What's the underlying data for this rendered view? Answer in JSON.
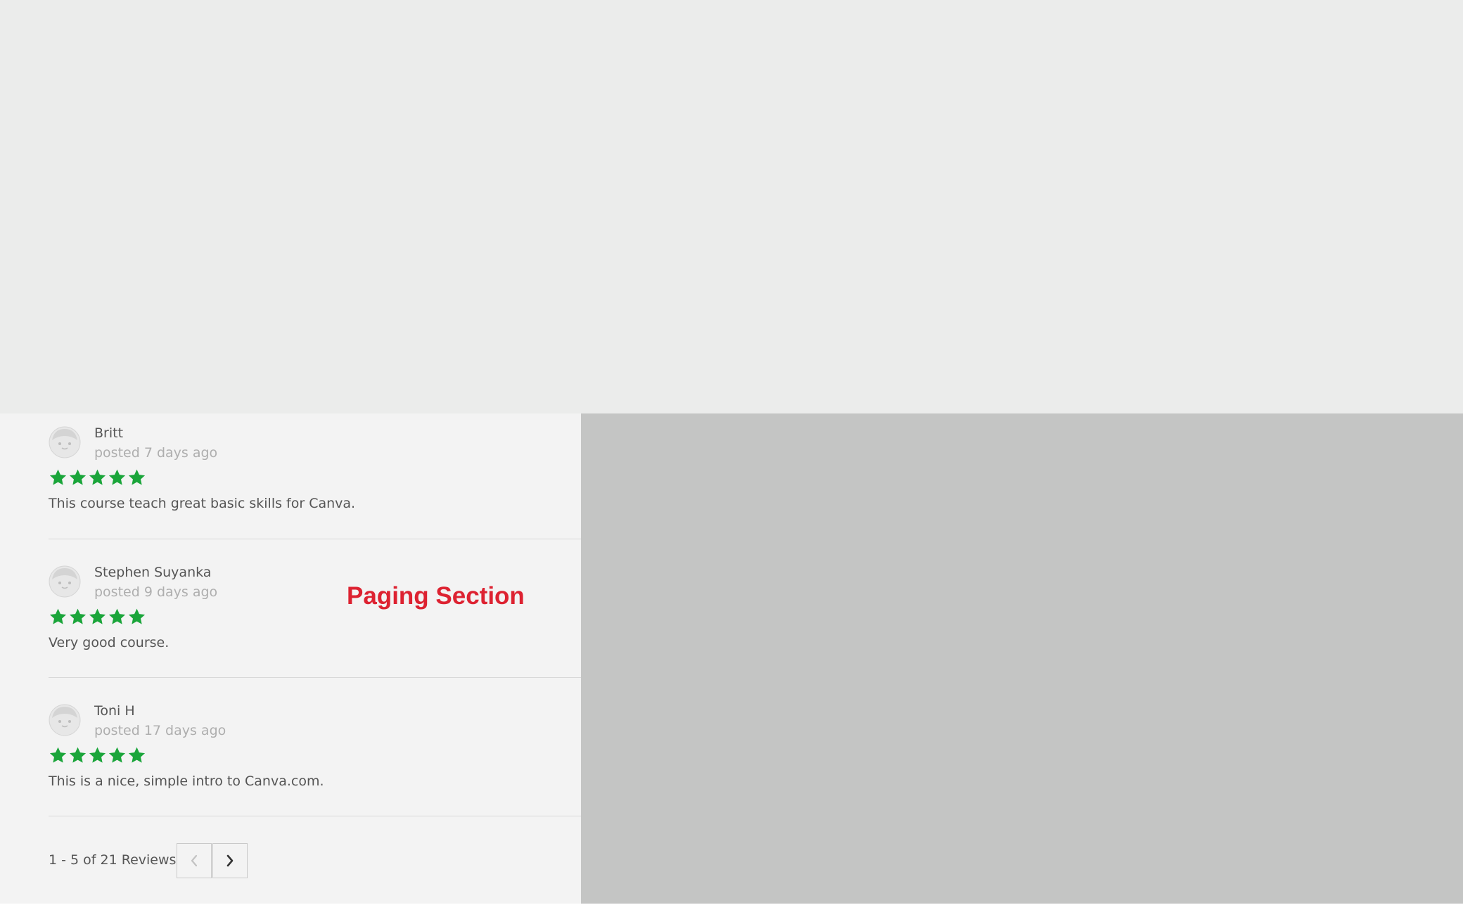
{
  "annotation": {
    "text": "Paging Section",
    "color": "#dd2231"
  },
  "reviews": [
    {
      "name": "Britt",
      "posted": "posted 7 days ago",
      "rating": 5,
      "text": "This course teach great basic skills for Canva."
    },
    {
      "name": "Stephen Suyanka",
      "posted": "posted 9 days ago",
      "rating": 5,
      "text": "Very good course."
    },
    {
      "name": "Toni H",
      "posted": "posted 17 days ago",
      "rating": 5,
      "text": "This is a nice, simple intro to Canva.com."
    }
  ],
  "paging": {
    "summary": "1 - 5 of 21 Reviews",
    "prev_icon": "chevron-left-icon",
    "next_icon": "chevron-right-icon",
    "prev_disabled": true
  },
  "colors": {
    "star": "#1aa53a",
    "top_band": "#ebeceb",
    "reviews_panel": "#f3f3f3",
    "side_panel": "#c4c5c4"
  }
}
